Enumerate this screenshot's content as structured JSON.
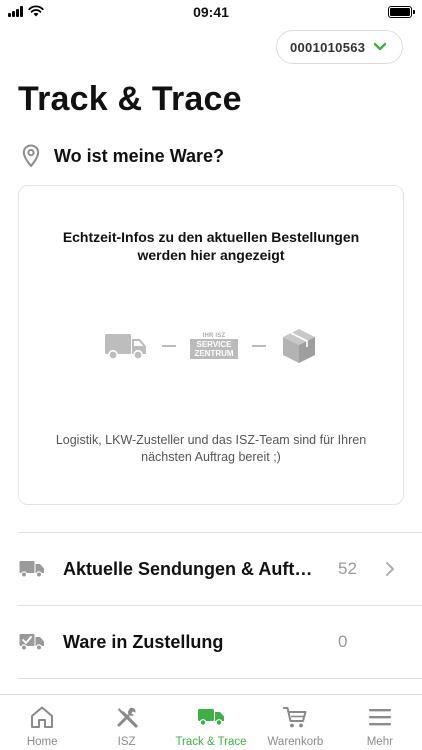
{
  "status_bar": {
    "time": "09:41"
  },
  "customer": {
    "number": "0001010563",
    "accent": "#3fae49"
  },
  "page_title": "Track & Trace",
  "section": {
    "title": "Wo ist meine Ware?"
  },
  "info_card": {
    "title": "Echtzeit-Infos zu den aktuellen Bestellungen werden hier angezeigt",
    "service_logo_top": "IHR ISZ",
    "service_logo_text": "SERVICE ZENTRUM",
    "footer": "Logistik, LKW-Zusteller und das ISZ-Team sind für Ihren nächsten Auftrag bereit ;)"
  },
  "list": [
    {
      "label": "Aktuelle Sendungen & Aufträge",
      "count": "52",
      "icon": "truck-icon",
      "has_chevron": true
    },
    {
      "label": "Ware in Zustellung",
      "count": "0",
      "icon": "truck-check-icon",
      "has_chevron": false
    }
  ],
  "tabs": [
    {
      "label": "Home",
      "icon": "home-icon",
      "active": false
    },
    {
      "label": "ISZ",
      "icon": "tools-icon",
      "active": false
    },
    {
      "label": "Track & Trace",
      "icon": "truck-icon",
      "active": true
    },
    {
      "label": "Warenkorb",
      "icon": "cart-icon",
      "active": false
    },
    {
      "label": "Mehr",
      "icon": "menu-icon",
      "active": false
    }
  ]
}
